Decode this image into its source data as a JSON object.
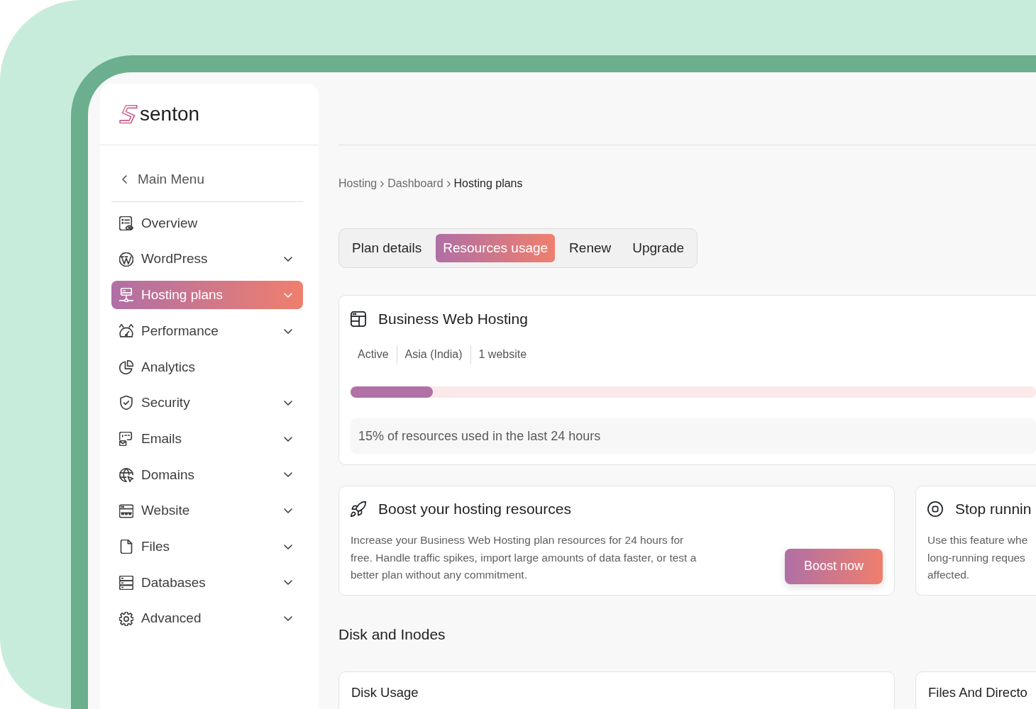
{
  "brand": {
    "name": "senton"
  },
  "sidebar": {
    "back_link": "Main Menu",
    "items": [
      {
        "label": "Overview",
        "expandable": false,
        "selected": false
      },
      {
        "label": "WordPress",
        "expandable": true,
        "selected": false
      },
      {
        "label": "Hosting plans",
        "expandable": true,
        "selected": true
      },
      {
        "label": "Performance",
        "expandable": true,
        "selected": false
      },
      {
        "label": "Analytics",
        "expandable": false,
        "selected": false
      },
      {
        "label": "Security",
        "expandable": true,
        "selected": false
      },
      {
        "label": "Emails",
        "expandable": true,
        "selected": false
      },
      {
        "label": "Domains",
        "expandable": true,
        "selected": false
      },
      {
        "label": "Website",
        "expandable": true,
        "selected": false
      },
      {
        "label": "Files",
        "expandable": true,
        "selected": false
      },
      {
        "label": "Databases",
        "expandable": true,
        "selected": false
      },
      {
        "label": "Advanced",
        "expandable": true,
        "selected": false
      }
    ]
  },
  "breadcrumb": [
    {
      "label": "Hosting",
      "current": false
    },
    {
      "label": "Dashboard",
      "current": false
    },
    {
      "label": "Hosting plans",
      "current": true
    }
  ],
  "tabs": [
    {
      "label": "Plan details",
      "selected": false
    },
    {
      "label": "Resources usage",
      "selected": true
    },
    {
      "label": "Renew",
      "selected": false
    },
    {
      "label": "Upgrade",
      "selected": false
    }
  ],
  "plan_card": {
    "title": "Business Web Hosting",
    "meta": [
      "Active",
      "Asia (India)",
      "1 website"
    ],
    "usage": {
      "level": 0.12
    },
    "usage_note": "15% of resources used in the last 24 hours"
  },
  "feature_cards": [
    {
      "kind": "boost",
      "title": "Boost your hosting resources",
      "description_lines": [
        "Increase your Business Web Hosting plan resources for 24 hours for",
        "free. Handle traffic spikes, import large amounts of data faster, or test a",
        "better plan without any commitment."
      ],
      "button": "Boost now"
    },
    {
      "kind": "stop",
      "title": "Stop runnin",
      "description_lines": [
        "Use this feature whe",
        "long-running reques",
        "affected."
      ]
    }
  ],
  "section": {
    "heading": "Disk and Inodes",
    "cards": [
      {
        "title": "Disk Usage"
      },
      {
        "title": "Files And Directo"
      }
    ]
  }
}
